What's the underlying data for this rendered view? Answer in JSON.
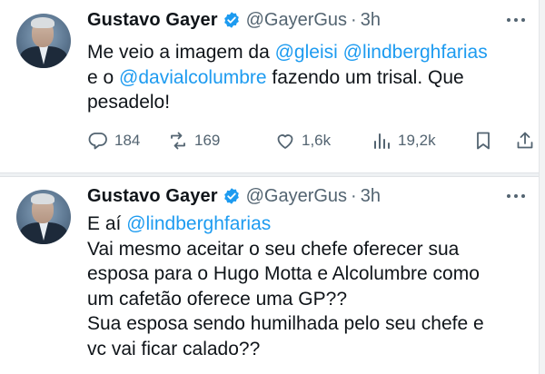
{
  "tweets": [
    {
      "display_name": "Gustavo Gayer",
      "handle": "@GayerGus",
      "separator": "·",
      "time": "3h",
      "avatar": "profile-photo",
      "verified_color": "#1d9bf0",
      "text": {
        "l1a": "Me veio a imagem da ",
        "l1m1": "@gleisi",
        "l1s": " ",
        "l1m2": "@lindberghfarias",
        "l2a": "e o ",
        "l2m": "@davialcolumbre",
        "l2b": " fazendo um trisal. Que",
        "l3": "pesadelo!"
      },
      "actions": {
        "replies": "184",
        "retweets": "169",
        "likes": "1,6k",
        "views": "19,2k"
      }
    },
    {
      "display_name": "Gustavo Gayer",
      "handle": "@GayerGus",
      "separator": "·",
      "time": "3h",
      "avatar": "profile-photo",
      "verified_color": "#1d9bf0",
      "text": {
        "l1a": "E aí ",
        "l1m": "@lindberghfarias",
        "l2": "Vai mesmo aceitar o seu chefe oferecer sua",
        "l3": "esposa para o Hugo Motta e Alcolumbre como",
        "l4": "um cafetão oferece uma GP??",
        "l5": "Sua esposa sendo humilhada pelo seu chefe e",
        "l6": "vc vai ficar calado??"
      }
    }
  ],
  "colors": {
    "mention": "#1d9bf0",
    "secondary_text": "#536471",
    "primary_text": "#0f1419"
  },
  "icons": [
    "reply-icon",
    "retweet-icon",
    "like-icon",
    "views-icon",
    "bookmark-icon",
    "share-icon",
    "more-icon",
    "verified-badge-icon"
  ]
}
